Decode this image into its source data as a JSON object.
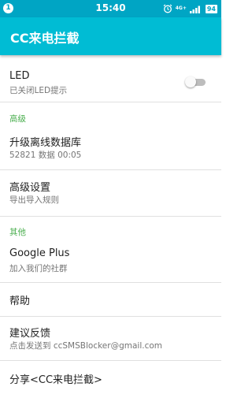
{
  "status_bar": {
    "notification_badge": "1",
    "time": "15:40",
    "network_label": "4G+",
    "battery_level": "94"
  },
  "app_bar": {
    "title": "CC来电拦截"
  },
  "settings": {
    "led": {
      "label": "LED",
      "summary": "已关闭LED提示",
      "enabled": false
    },
    "section_advanced": "高级",
    "upgrade_db": {
      "label": "升级离线数据库",
      "summary": "52821 数据 00:05"
    },
    "advanced_settings": {
      "label": "高级设置",
      "summary": "导出导入规则"
    },
    "section_other": "其他",
    "google_plus": {
      "label": "Google Plus",
      "summary": "加入我们的社群"
    },
    "help": {
      "label": "帮助"
    },
    "feedback": {
      "label": "建议反馈",
      "summary": "点击发送到 ccSMSBlocker@gmail.com"
    },
    "share": {
      "label": "分享<CC来电拦截>"
    }
  },
  "colors": {
    "status_bar": "#00a5c4",
    "app_bar": "#00bcd4",
    "section_header": "#4caf50",
    "divider": "#e0e0e0"
  }
}
